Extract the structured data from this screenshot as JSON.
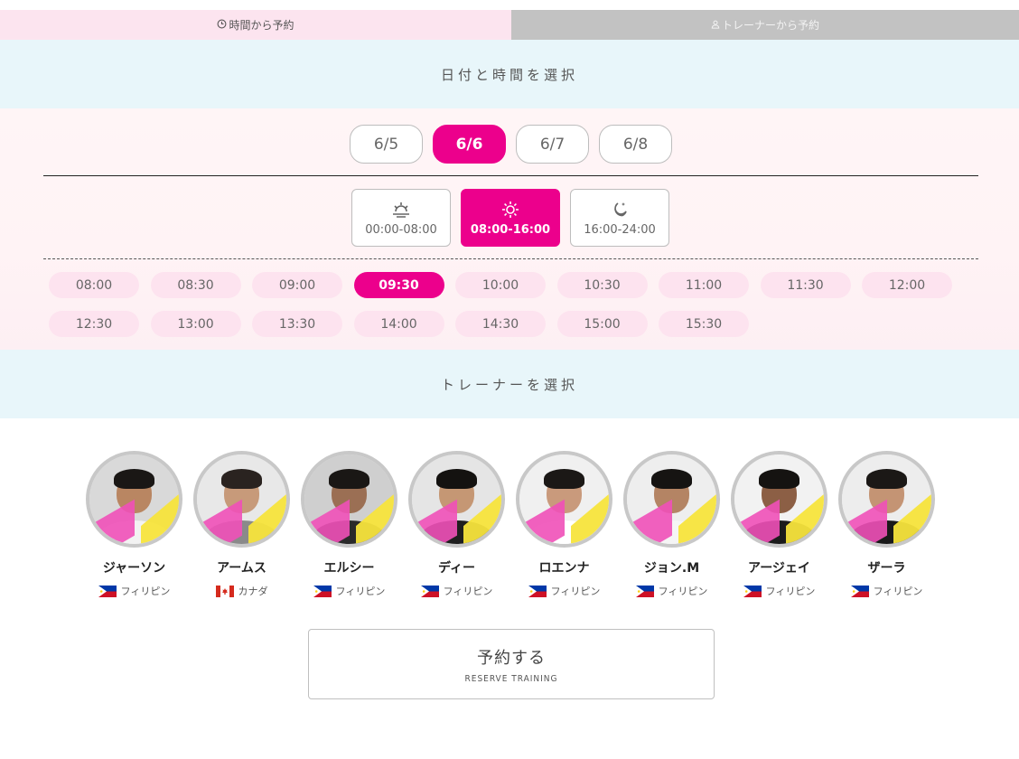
{
  "tabs": {
    "time": "時間から予約",
    "trainer": "トレーナーから予約"
  },
  "section_date_title": "日付と時間を選択",
  "section_trainer_title": "トレーナーを選択",
  "dates": [
    {
      "label": "6/5",
      "selected": false
    },
    {
      "label": "6/6",
      "selected": true
    },
    {
      "label": "6/7",
      "selected": false
    },
    {
      "label": "6/8",
      "selected": false
    }
  ],
  "periods": [
    {
      "label": "00:00-08:00",
      "icon": "sunrise-icon",
      "selected": false
    },
    {
      "label": "08:00-16:00",
      "icon": "sun-icon",
      "selected": true
    },
    {
      "label": "16:00-24:00",
      "icon": "moon-icon",
      "selected": false
    }
  ],
  "times": [
    {
      "label": "08:00",
      "selected": false
    },
    {
      "label": "08:30",
      "selected": false
    },
    {
      "label": "09:00",
      "selected": false
    },
    {
      "label": "09:30",
      "selected": true
    },
    {
      "label": "10:00",
      "selected": false
    },
    {
      "label": "10:30",
      "selected": false
    },
    {
      "label": "11:00",
      "selected": false
    },
    {
      "label": "11:30",
      "selected": false
    },
    {
      "label": "12:00",
      "selected": false
    },
    {
      "label": "12:30",
      "selected": false
    },
    {
      "label": "13:00",
      "selected": false
    },
    {
      "label": "13:30",
      "selected": false
    },
    {
      "label": "14:00",
      "selected": false
    },
    {
      "label": "14:30",
      "selected": false
    },
    {
      "label": "15:00",
      "selected": false
    },
    {
      "label": "15:30",
      "selected": false
    }
  ],
  "trainers": [
    {
      "name": "ジャーソン",
      "country": "フィリピン",
      "flag": "philippines-flag-icon"
    },
    {
      "name": "アームス",
      "country": "カナダ",
      "flag": "canada-flag-icon"
    },
    {
      "name": "エルシー",
      "country": "フィリピン",
      "flag": "philippines-flag-icon"
    },
    {
      "name": "ディー",
      "country": "フィリピン",
      "flag": "philippines-flag-icon"
    },
    {
      "name": "ロエンナ",
      "country": "フィリピン",
      "flag": "philippines-flag-icon"
    },
    {
      "name": "ジョン.M",
      "country": "フィリピン",
      "flag": "philippines-flag-icon"
    },
    {
      "name": "アージェイ",
      "country": "フィリピン",
      "flag": "philippines-flag-icon"
    },
    {
      "name": "ザーラ",
      "country": "フィリピン",
      "flag": "philippines-flag-icon"
    }
  ],
  "reserve": {
    "main": "予約する",
    "sub": "RESERVE TRAINING"
  },
  "colors": {
    "accent": "#ec008c",
    "slot_bg": "#fde3ef",
    "section_bg": "#e8f6fa",
    "tab_active_bg": "#fce4ef",
    "tab_inactive_bg": "#c2c2c2"
  }
}
